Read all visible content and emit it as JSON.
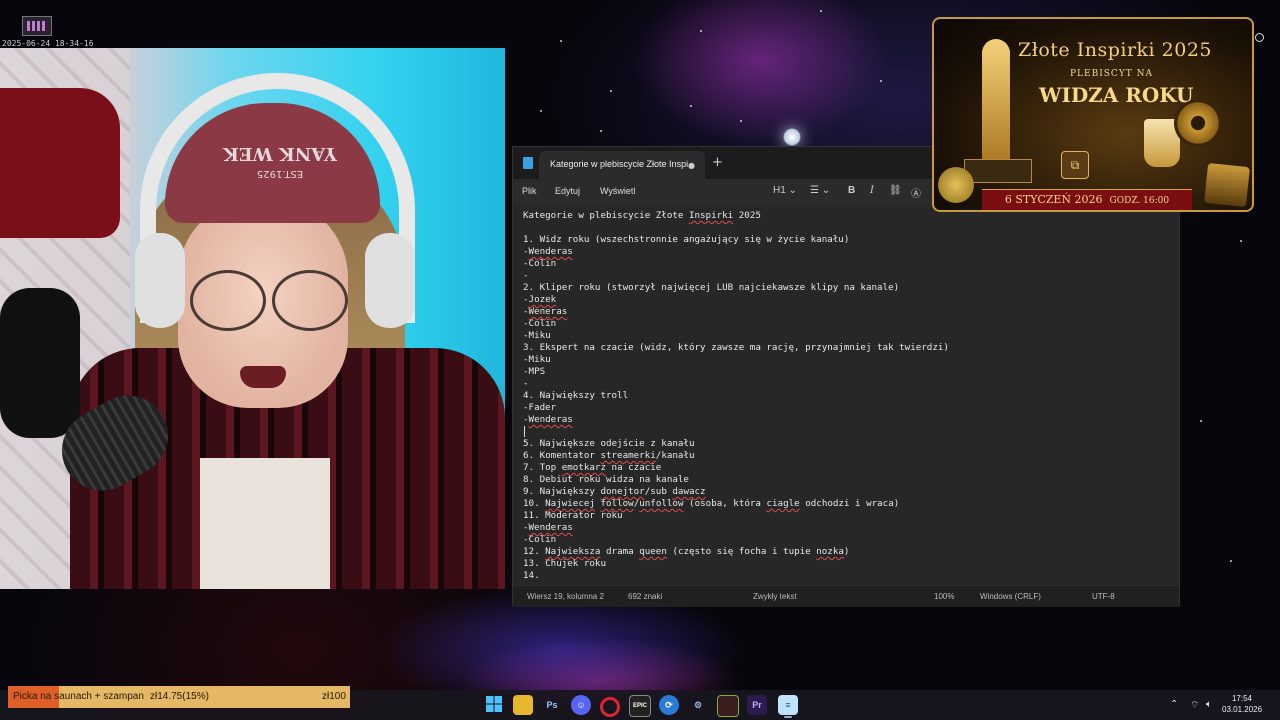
{
  "overlay": {
    "timestamp": "2025-06-24 18-34-16"
  },
  "webcam": {
    "cap_text": "YANK WEK",
    "cap_sub": "EST.1925"
  },
  "notepad": {
    "tab_title": "Kategorie w plebiscycie Złote Inspi",
    "tab_modified_indicator": "●",
    "new_tab_symbol": "+",
    "menu": [
      "Plik",
      "Edytuj",
      "Wyświetl"
    ],
    "toolbar": {
      "heading": "H1",
      "bold": "B",
      "italic": "I"
    },
    "lines": [
      [
        {
          "t": "Kategorie w plebiscycie Złote "
        },
        {
          "t": "Inspirki",
          "s": true
        },
        {
          "t": " 2025"
        }
      ],
      [
        {
          "t": ""
        }
      ],
      [
        {
          "t": "1. Widz roku (wszechstronnie angażujący się w życie kanału)"
        }
      ],
      [
        {
          "t": "-"
        },
        {
          "t": "Wenderas",
          "s": true
        }
      ],
      [
        {
          "t": "-Colin"
        }
      ],
      [
        {
          "t": "-"
        }
      ],
      [
        {
          "t": "2. Kliper roku (stworzył najwięcej LUB najciekawsze klipy na kanale)"
        }
      ],
      [
        {
          "t": "-"
        },
        {
          "t": "Jozek",
          "s": true
        }
      ],
      [
        {
          "t": "-"
        },
        {
          "t": "Weneras",
          "s": true
        }
      ],
      [
        {
          "t": "-Colin"
        }
      ],
      [
        {
          "t": "-Miku"
        }
      ],
      [
        {
          "t": "3. Ekspert na czacie (widz, który zawsze ma rację, przynajmniej tak twierdzi)"
        }
      ],
      [
        {
          "t": "-Miku"
        }
      ],
      [
        {
          "t": "-MPS"
        }
      ],
      [
        {
          "t": "-"
        }
      ],
      [
        {
          "t": "4. Największy troll"
        }
      ],
      [
        {
          "t": "-Fader"
        }
      ],
      [
        {
          "t": "-"
        },
        {
          "t": "Wenderas",
          "s": true
        }
      ],
      [
        {
          "t": ""
        }
      ],
      [
        {
          "t": "5. Największe odejście z kanału"
        }
      ],
      [
        {
          "t": "6. Komentator "
        },
        {
          "t": "streamerki",
          "s": true
        },
        {
          "t": "/kanału"
        }
      ],
      [
        {
          "t": "7. Top "
        },
        {
          "t": "emotkarz",
          "s": true
        },
        {
          "t": " na czacie"
        }
      ],
      [
        {
          "t": "8. Debiut roku widza na kanale"
        }
      ],
      [
        {
          "t": "9. Największy "
        },
        {
          "t": "donejtor",
          "s": true
        },
        {
          "t": "/sub "
        },
        {
          "t": "dawacz",
          "s": true
        }
      ],
      [
        {
          "t": "10. "
        },
        {
          "t": "Najwiecej",
          "s": true
        },
        {
          "t": " "
        },
        {
          "t": "follow",
          "s": true
        },
        {
          "t": "/"
        },
        {
          "t": "unfollow",
          "s": true
        },
        {
          "t": " (osoba, która "
        },
        {
          "t": "ciagle",
          "s": true
        },
        {
          "t": " odchodzi i wraca)"
        }
      ],
      [
        {
          "t": "11. Moderator roku"
        }
      ],
      [
        {
          "t": "-"
        },
        {
          "t": "Wenderas",
          "s": true
        }
      ],
      [
        {
          "t": "-Colin"
        }
      ],
      [
        {
          "t": "12. "
        },
        {
          "t": "Najwieksza",
          "s": true
        },
        {
          "t": " drama "
        },
        {
          "t": "queen",
          "s": true
        },
        {
          "t": " (często się focha i tupie "
        },
        {
          "t": "nozka",
          "s": true
        },
        {
          "t": ")"
        }
      ],
      [
        {
          "t": "13. Chujek roku"
        }
      ],
      [
        {
          "t": "14."
        }
      ]
    ],
    "status": {
      "position": "Wiersz 19, kolumna 2",
      "chars": "692 znaki",
      "format": "Zwykły tekst",
      "zoom": "100%",
      "line_endings": "Windows (CRLF)",
      "encoding": "UTF-8"
    }
  },
  "banner": {
    "title": "Złote Inspirki 2025",
    "subtitle": "PLEBISCYT NA",
    "headline": "WIDZA ROKU",
    "date": "6 STYCZEŃ 2026",
    "time": "GODZ. 16:00"
  },
  "goal": {
    "label": "Picka na saunach + szampan",
    "current": "zł14.75(15%)",
    "target": "zł100",
    "progress": 0.15
  },
  "taskbar": {
    "icons": [
      "start-icon",
      "file-explorer-icon",
      "photoshop-icon",
      "discord-icon",
      "opera-icon",
      "epic-games-icon",
      "vscode-icon",
      "steam-icon",
      "app-icon",
      "premiere-icon",
      "notepad-icon"
    ],
    "labels": {
      "photoshop": "Ps",
      "epic": "EPIC",
      "premiere": "Pr"
    },
    "clock_time": "17:54",
    "clock_date": "03.01.2026"
  },
  "colors": {
    "accent": "#3aa0e6",
    "spellcheck": "#e04a4a",
    "goal_fill": "#df5f28",
    "goal_bg": "#e4b864",
    "banner_gold": "#f3cf76"
  }
}
